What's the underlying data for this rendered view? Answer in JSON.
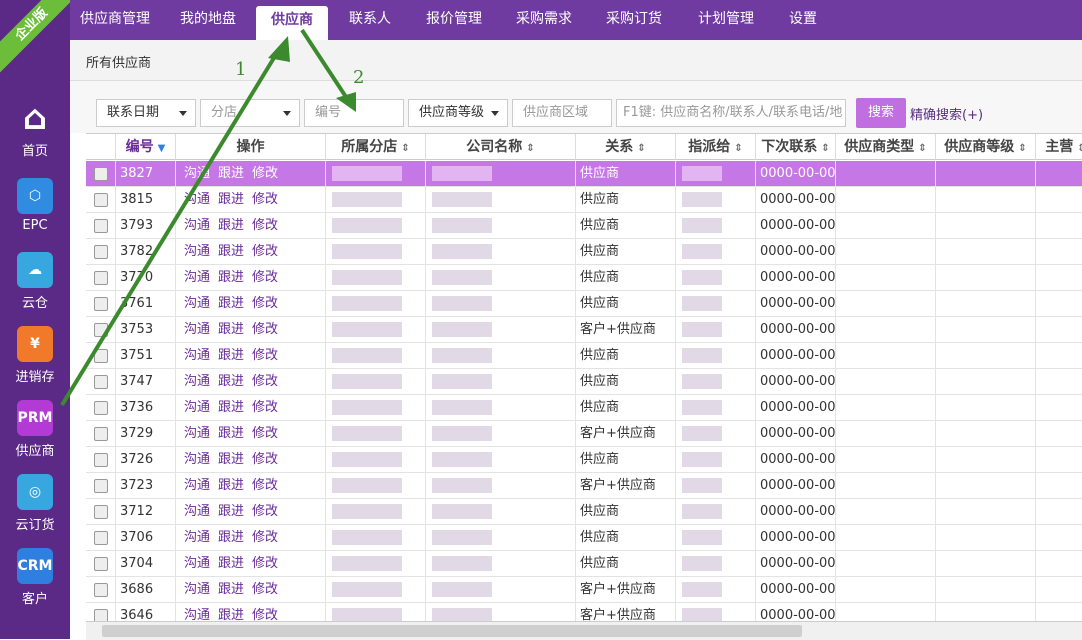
{
  "badge": "企业版",
  "sidebar": {
    "items": [
      {
        "label": "首页",
        "icon": "home-icon",
        "color": "#5b2a86",
        "glyph": "⌂"
      },
      {
        "label": "EPC",
        "icon": "hexagon-network-icon",
        "color": "#2f8ce0",
        "glyph": "⬡"
      },
      {
        "label": "云仓",
        "icon": "cloud-icon",
        "color": "#38a7e0",
        "glyph": "☁"
      },
      {
        "label": "进销存",
        "icon": "yuan-icon",
        "color": "#f07a2a",
        "glyph": "¥"
      },
      {
        "label": "供应商",
        "icon": "prm-icon",
        "color": "#b43ad6",
        "glyph": "PRM"
      },
      {
        "label": "云订货",
        "icon": "chat-order-icon",
        "color": "#38a7e0",
        "glyph": "◎"
      },
      {
        "label": "客户",
        "icon": "crm-icon",
        "color": "#2f7fe0",
        "glyph": "CRM"
      }
    ]
  },
  "topnav": {
    "items": [
      "供应商管理",
      "我的地盘",
      "供应商",
      "联系人",
      "报价管理",
      "采购需求",
      "采购订货",
      "计划管理",
      "设置"
    ],
    "active_index": 2
  },
  "breadcrumb": "所有供应商",
  "filters": {
    "date_select": "联系日期",
    "branch_placeholder": "分店",
    "number_placeholder": "编号",
    "level_select": "供应商等级",
    "region_placeholder": "供应商区域",
    "keyword_placeholder": "F1键: 供应商名称/联系人/联系电话/地",
    "search_button": "搜索",
    "precise_search": "精确搜索(+)"
  },
  "table": {
    "headers": [
      "编号",
      "操作",
      "所属分店",
      "公司名称",
      "关系",
      "指派给",
      "下次联系",
      "供应商类型",
      "供应商等级",
      "主营"
    ],
    "actions": [
      "沟通",
      "跟进",
      "修改"
    ],
    "rows": [
      {
        "id": "3827",
        "relation": "供应商",
        "next": "0000-00-00"
      },
      {
        "id": "3815",
        "relation": "供应商",
        "next": "0000-00-00"
      },
      {
        "id": "3793",
        "relation": "供应商",
        "next": "0000-00-00"
      },
      {
        "id": "3782",
        "relation": "供应商",
        "next": "0000-00-00"
      },
      {
        "id": "3770",
        "relation": "供应商",
        "next": "0000-00-00"
      },
      {
        "id": "3761",
        "relation": "供应商",
        "next": "0000-00-00"
      },
      {
        "id": "3753",
        "relation": "客户+供应商",
        "next": "0000-00-00"
      },
      {
        "id": "3751",
        "relation": "供应商",
        "next": "0000-00-00"
      },
      {
        "id": "3747",
        "relation": "供应商",
        "next": "0000-00-00"
      },
      {
        "id": "3736",
        "relation": "供应商",
        "next": "0000-00-00"
      },
      {
        "id": "3729",
        "relation": "客户+供应商",
        "next": "0000-00-00"
      },
      {
        "id": "3726",
        "relation": "供应商",
        "next": "0000-00-00"
      },
      {
        "id": "3723",
        "relation": "客户+供应商",
        "next": "0000-00-00"
      },
      {
        "id": "3712",
        "relation": "供应商",
        "next": "0000-00-00"
      },
      {
        "id": "3706",
        "relation": "供应商",
        "next": "0000-00-00"
      },
      {
        "id": "3704",
        "relation": "供应商",
        "next": "0000-00-00"
      },
      {
        "id": "3686",
        "relation": "客户+供应商",
        "next": "0000-00-00"
      },
      {
        "id": "3646",
        "relation": "客户+供应商",
        "next": "0000-00-00"
      }
    ]
  },
  "annotations": {
    "label1": "1",
    "label2": "2",
    "color": "#2e7d32"
  }
}
